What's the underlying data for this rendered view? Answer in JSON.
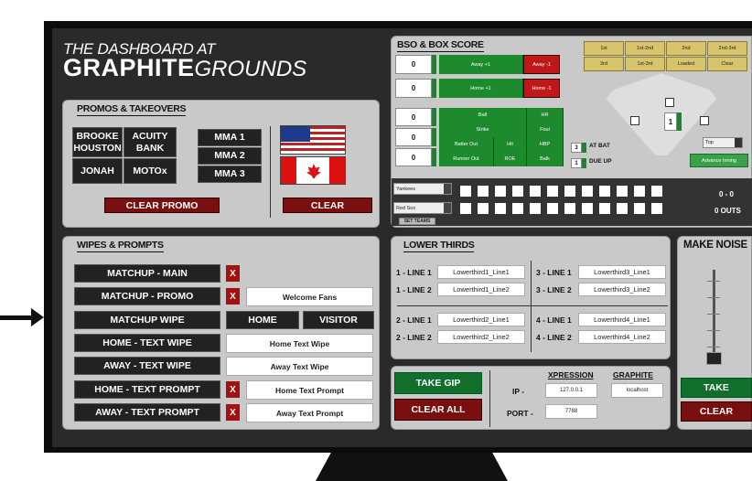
{
  "header": {
    "line1": "THE DASHBOARD AT",
    "brand_bold": "GRAPHITE",
    "brand_light": "GROUNDS"
  },
  "promos": {
    "title": "PROMOS & TAKEOVERS",
    "buttons": [
      "BROOKE HOUSTON",
      "ACUITY BANK",
      "MMA 1",
      "MMA 2",
      "JONAH",
      "MOTOx",
      "MMA 3"
    ],
    "clear_promo": "CLEAR PROMO",
    "clear": "CLEAR"
  },
  "bso": {
    "title": "BSO & BOX SCORE",
    "away_score": "0",
    "home_score": "0",
    "away_plus": "Away +1",
    "away_minus": "Away -1",
    "home_plus": "Home +1",
    "home_minus": "Home -1",
    "count": [
      "0",
      "0",
      "0"
    ],
    "stats": [
      "Ball",
      "HR",
      "Strike",
      "Foul",
      "Batter Out",
      "Hit",
      "HBP",
      "Runner Out",
      "ROE",
      "Balk"
    ],
    "bases": [
      "1st",
      "1st-2nd",
      "2nd",
      "2nd-3rd",
      "3rd",
      "1st-3rd",
      "Loaded",
      "Clear"
    ],
    "at_bat_value": "3",
    "at_bat": "AT BAT",
    "due_up_value": "1",
    "due_up": "DUE UP",
    "inning_value": "1",
    "half": "Top",
    "advance_inning": "Advance Inning",
    "teams": [
      "Yankees",
      "Red Sox"
    ],
    "set_teams": "SET TEAMS",
    "runs": "0 - 0",
    "outs": "0 OUTS"
  },
  "wipes": {
    "title": "WIPES & PROMPTS",
    "rows": [
      "MATCHUP - MAIN",
      "MATCHUP - PROMO",
      "MATCHUP WIPE",
      "HOME - TEXT WIPE",
      "AWAY - TEXT WIPE",
      "HOME - TEXT PROMPT",
      "AWAY - TEXT PROMPT"
    ],
    "x": "X",
    "welcome": "Welcome Fans",
    "home": "HOME",
    "visitor": "VISITOR",
    "home_text_wipe": "Home Text Wipe",
    "away_text_wipe": "Away Text Wipe",
    "home_text_prompt": "Home Text Prompt",
    "away_text_prompt": "Away Text Prompt"
  },
  "lower_thirds": {
    "title": "LOWER THIRDS",
    "labels": [
      "1 - LINE 1",
      "1 - LINE 2",
      "2 - LINE 1",
      "2 - LINE 2",
      "3 - LINE 1",
      "3 - LINE 2",
      "4 - LINE 1",
      "4 - LINE 2"
    ],
    "values": [
      "Lowerthird1_Line1",
      "Lowerthird1_Line2",
      "Lowerthird2_Line1",
      "Lowerthird2_Line2",
      "Lowerthird3_Line1",
      "Lowerthird3_Line2",
      "Lowerthird4_Line1",
      "Lowerthird4_Line2"
    ]
  },
  "connection": {
    "take_gip": "TAKE GIP",
    "clear_all": "CLEAR ALL",
    "xpression": "XPRESSION",
    "graphite": "GRAPHITE",
    "ip_label": "IP -",
    "ip": "127.0.0.1",
    "host": "localhost",
    "port_label": "PORT -",
    "port": "7788"
  },
  "noise": {
    "title": "MAKE NOISE",
    "take": "TAKE",
    "clear": "CLEAR"
  }
}
